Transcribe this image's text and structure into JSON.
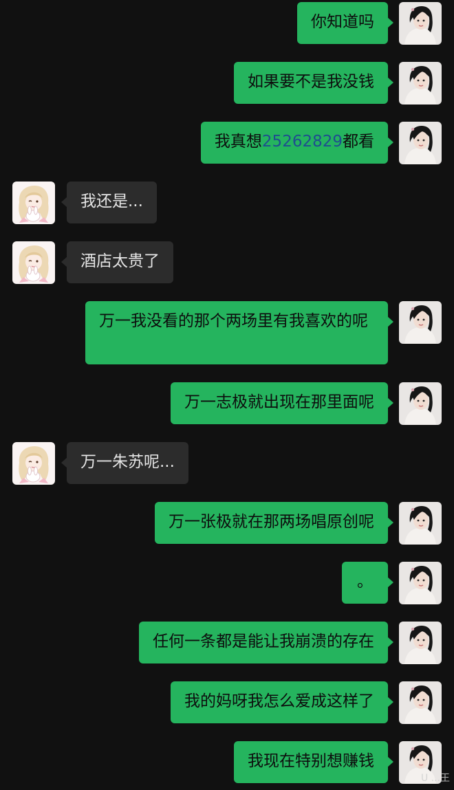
{
  "messages": [
    {
      "from": "me",
      "text": "你知道吗"
    },
    {
      "from": "me",
      "text": "如果要不是我没钱"
    },
    {
      "from": "me",
      "text_before": "我真想",
      "number": "25262829",
      "text_after": "都看"
    },
    {
      "from": "other",
      "text": "我还是..."
    },
    {
      "from": "other",
      "text": "酒店太贵了"
    },
    {
      "from": "me",
      "text": "万一我没看的那个两场里有我喜欢的呢"
    },
    {
      "from": "me",
      "text": "万一志极就出现在那里面呢"
    },
    {
      "from": "other",
      "text": "万一朱苏呢..."
    },
    {
      "from": "me",
      "text": "万一张极就在那两场唱原创呢"
    },
    {
      "from": "me",
      "text": "。"
    },
    {
      "from": "me",
      "text": "任何一条都是能让我崩溃的存在"
    },
    {
      "from": "me",
      "text": "我的妈呀我怎么爱成这样了"
    },
    {
      "from": "me",
      "text": "我现在特别想赚钱"
    }
  ],
  "avatars": {
    "me": "girl-portrait-avatar",
    "other": "anime-girl-with-bunny-avatar"
  },
  "colors": {
    "background": "#111111",
    "sent_bubble": "#25b45e",
    "received_bubble": "#2c2c2c",
    "number_link": "#1f4e8f"
  },
  "watermark": "U ...王"
}
